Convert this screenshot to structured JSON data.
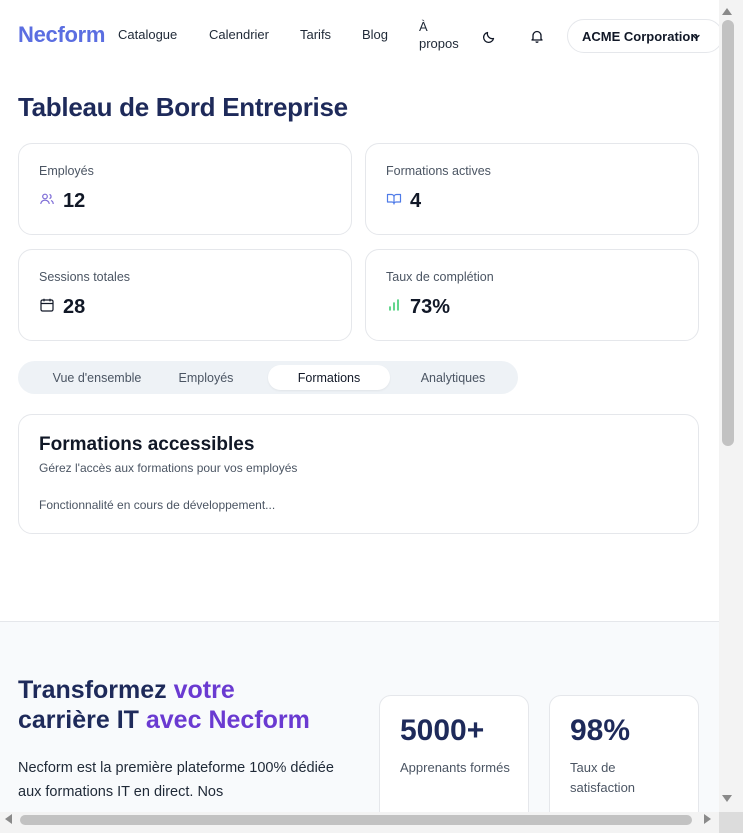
{
  "nav": {
    "logo": "Necform",
    "links": [
      "Catalogue",
      "Calendrier",
      "Tarifs",
      "Blog"
    ],
    "about": "À propos",
    "theme_icon": "moon-icon",
    "notif_icon": "bell-icon",
    "org_selector": "ACME Corporation"
  },
  "dashboard": {
    "title": "Tableau de Bord Entreprise",
    "stats": [
      {
        "label": "Employés",
        "value": "12",
        "icon": "users-icon"
      },
      {
        "label": "Formations actives",
        "value": "4",
        "icon": "book-open-icon"
      },
      {
        "label": "Sessions totales",
        "value": "28",
        "icon": "calendar-icon"
      },
      {
        "label": "Taux de complétion",
        "value": "73%",
        "icon": "bar-chart-icon"
      }
    ],
    "tabs": [
      "Vue d'ensemble",
      "Employés",
      "Formations",
      "Analytiques"
    ],
    "active_tab": "Formations",
    "panel": {
      "title": "Formations accessibles",
      "subtitle": "Gérez l'accès aux formations pour vos employés",
      "note": "Fonctionnalité en cours de développement..."
    }
  },
  "promo": {
    "heading_part1": "Transformez",
    "heading_part2": "votre",
    "heading_part3": "carrière IT",
    "heading_part4": "avec",
    "heading_part5": "Necform",
    "paragraph": "Necform est la première plateforme 100% dédiée aux formations IT en direct. Nos",
    "stats": [
      {
        "number": "5000+",
        "caption": "Apprenants formés"
      },
      {
        "number": "98%",
        "caption": "Taux de satisfaction"
      }
    ]
  },
  "colors": {
    "brand": "#5b6ee1",
    "heading": "#1e2a5a",
    "accent_purple": "#6a3ad1",
    "green": "#22c55e"
  }
}
